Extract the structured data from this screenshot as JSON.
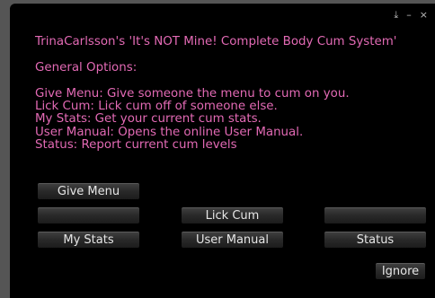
{
  "window": {
    "controls": {
      "download": "⤓",
      "minimize": "–",
      "close": "×"
    }
  },
  "message": {
    "title": "TrinaCarlsson's 'It's NOT Mine! Complete Body Cum System'",
    "section": "General Options:",
    "lines": [
      "Give Menu: Give someone the menu to cum on you.",
      "Lick Cum: Lick cum off of someone else.",
      "My Stats: Get your current cum stats.",
      "User Manual: Opens the online User Manual.",
      "Status: Report current cum levels"
    ]
  },
  "buttons": {
    "give_menu": "Give Menu",
    "blank_left": "",
    "lick_cum": "Lick Cum",
    "blank_right": "",
    "my_stats": "My Stats",
    "user_manual": "User Manual",
    "status": "Status",
    "ignore": "Ignore"
  }
}
